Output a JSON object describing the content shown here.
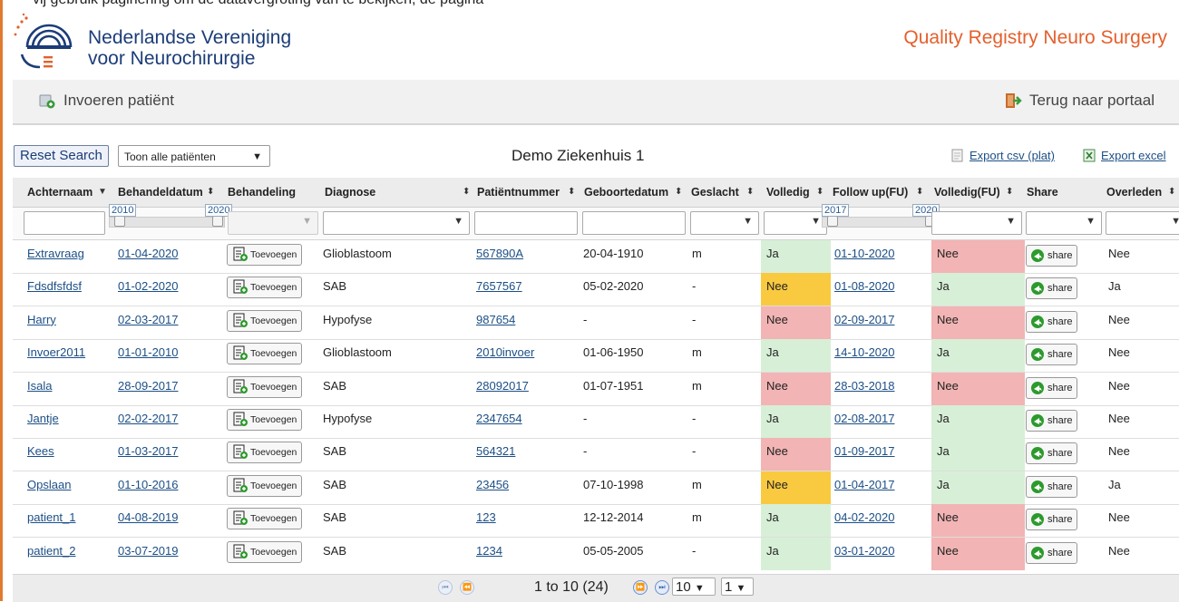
{
  "top_cut_text": "vij gebruik paginering om de datavergroting van te bekijken, de pagina",
  "header": {
    "org_line1": "Nederlandse Vereniging",
    "org_line2": "voor Neurochirurgie",
    "registry": "Quality Registry Neuro Surgery"
  },
  "toolbar": {
    "add_patient": "Invoeren patiënt",
    "back_to_portal": "Terug naar portaal",
    "add_icon": "add-document-icon",
    "exit_icon": "exit-door-icon"
  },
  "controls": {
    "reset_label": "Reset Search",
    "filter_value": "Toon alle patiënten",
    "hospital": "Demo Ziekenhuis 1",
    "export_csv": "Export csv (plat)",
    "export_excel": "Export excel"
  },
  "table": {
    "columns": [
      "Achternaam",
      "Behandeldatum",
      "Behandeling",
      "Diagnose",
      "Patiëntnummer",
      "Geboortedatum",
      "Geslacht",
      "Volledig",
      "Follow up(FU)",
      "Volledig(FU)",
      "Share",
      "Overleden"
    ],
    "range_behandel": {
      "min": "2010",
      "max": "2020"
    },
    "range_followup": {
      "min": "2017",
      "max": "2020"
    },
    "button_add": "Toevoegen",
    "button_share": "share",
    "rows": [
      {
        "achternaam": "Extravraag",
        "behandeldatum": "01-04-2020",
        "diagnose": "Glioblastoom",
        "patientnummer": "567890A",
        "geboortedatum": "20-04-1910",
        "geslacht": "m",
        "volledig": "Ja",
        "followup": "01-10-2020",
        "volledig_fu": "Nee",
        "overleden": "Nee"
      },
      {
        "achternaam": "Fdsdfsfdsf",
        "behandeldatum": "01-02-2020",
        "diagnose": "SAB",
        "patientnummer": "7657567",
        "geboortedatum": "05-02-2020",
        "geslacht": "-",
        "volledig": "Nee",
        "followup": "01-08-2020",
        "volledig_fu": "Ja",
        "overleden": "Ja"
      },
      {
        "achternaam": "Harry",
        "behandeldatum": "02-03-2017",
        "diagnose": "Hypofyse",
        "patientnummer": "987654",
        "geboortedatum": "-",
        "geslacht": "-",
        "volledig": "Nee",
        "followup": "02-09-2017",
        "volledig_fu": "Nee",
        "overleden": "Nee"
      },
      {
        "achternaam": "Invoer2011",
        "behandeldatum": "01-01-2010",
        "diagnose": "Glioblastoom",
        "patientnummer": "2010invoer",
        "geboortedatum": "01-06-1950",
        "geslacht": "m",
        "volledig": "Ja",
        "followup": "14-10-2020",
        "volledig_fu": "Ja",
        "overleden": "Nee"
      },
      {
        "achternaam": "Isala",
        "behandeldatum": "28-09-2017",
        "diagnose": "SAB",
        "patientnummer": "28092017",
        "geboortedatum": "01-07-1951",
        "geslacht": "m",
        "volledig": "Nee",
        "followup": "28-03-2018",
        "volledig_fu": "Nee",
        "overleden": "Nee"
      },
      {
        "achternaam": "Jantje",
        "behandeldatum": "02-02-2017",
        "diagnose": "Hypofyse",
        "patientnummer": "2347654",
        "geboortedatum": "-",
        "geslacht": "-",
        "volledig": "Ja",
        "followup": "02-08-2017",
        "volledig_fu": "Ja",
        "overleden": "Nee"
      },
      {
        "achternaam": "Kees",
        "behandeldatum": "01-03-2017",
        "diagnose": "SAB",
        "patientnummer": "564321",
        "geboortedatum": "-",
        "geslacht": "-",
        "volledig": "Nee",
        "followup": "01-09-2017",
        "volledig_fu": "Ja",
        "overleden": "Nee"
      },
      {
        "achternaam": "Opslaan",
        "behandeldatum": "01-10-2016",
        "diagnose": "SAB",
        "patientnummer": "23456",
        "geboortedatum": "07-10-1998",
        "geslacht": "m",
        "volledig": "Nee",
        "followup": "01-04-2017",
        "volledig_fu": "Ja",
        "overleden": "Ja"
      },
      {
        "achternaam": "patient_1",
        "behandeldatum": "04-08-2019",
        "diagnose": "SAB",
        "patientnummer": "123",
        "geboortedatum": "12-12-2014",
        "geslacht": "m",
        "volledig": "Ja",
        "followup": "04-02-2020",
        "volledig_fu": "Nee",
        "overleden": "Nee"
      },
      {
        "achternaam": "patient_2",
        "behandeldatum": "03-07-2019",
        "diagnose": "SAB",
        "patientnummer": "1234",
        "geboortedatum": "05-05-2005",
        "geslacht": "-",
        "volledig": "Ja",
        "followup": "03-01-2020",
        "volledig_fu": "Nee",
        "overleden": "Nee"
      }
    ]
  },
  "pager": {
    "summary": "1 to 10 (24)",
    "page_size": "10",
    "page": "1"
  },
  "colors": {
    "brand_blue": "#1c3c78",
    "brand_orange": "#e4602d",
    "status_green": "#d7efd7",
    "status_yellow": "#f9c940",
    "status_red": "#f2b4b4"
  }
}
